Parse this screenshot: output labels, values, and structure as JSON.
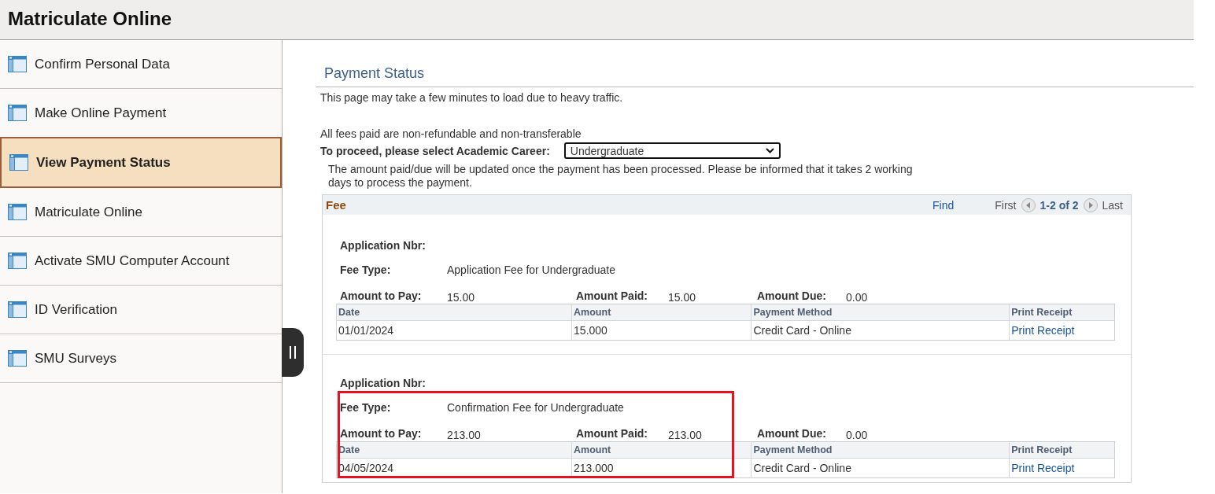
{
  "header": {
    "title": "Matriculate Online"
  },
  "sidebar": {
    "items": [
      {
        "label": "Confirm Personal Data",
        "selected": false
      },
      {
        "label": "Make Online Payment",
        "selected": false
      },
      {
        "label": "View Payment Status",
        "selected": true
      },
      {
        "label": "Matriculate Online",
        "selected": false
      },
      {
        "label": "Activate SMU Computer Account",
        "selected": false
      },
      {
        "label": "ID Verification",
        "selected": false
      },
      {
        "label": "SMU Surveys",
        "selected": false
      }
    ]
  },
  "page": {
    "title": "Payment Status",
    "notice": "This page may take a few minutes to load due to heavy traffic.",
    "fees_note": "All fees paid are non-refundable and non-transferable",
    "career_label": "To proceed, please select Academic Career:",
    "career_value": "Undergraduate",
    "update_note": "The amount paid/due will be updated once the payment has been processed. Please be informed that it takes 2 working days to process the payment."
  },
  "fee_grid": {
    "title": "Fee",
    "find": "Find",
    "first": "First",
    "range": "1-2 of 2",
    "last": "Last",
    "records": [
      {
        "application_nbr_label": "Application Nbr:",
        "fee_type_label": "Fee Type:",
        "fee_type": "Application Fee for Undergraduate",
        "amount_to_pay_label": "Amount to Pay:",
        "amount_to_pay": "15.00",
        "amount_paid_label": "Amount Paid:",
        "amount_paid": "15.00",
        "amount_due_label": "Amount Due:",
        "amount_due": "0.00",
        "highlighted": false,
        "columns": [
          "Date",
          "Amount",
          "Payment Method",
          "Print Receipt"
        ],
        "rows": [
          [
            "01/01/2024",
            "15.000",
            "Credit Card - Online",
            "Print Receipt"
          ]
        ]
      },
      {
        "application_nbr_label": "Application Nbr:",
        "fee_type_label": "Fee Type:",
        "fee_type": "Confirmation Fee for Undergraduate",
        "amount_to_pay_label": "Amount to Pay:",
        "amount_to_pay": "213.00",
        "amount_paid_label": "Amount Paid:",
        "amount_paid": "213.00",
        "amount_due_label": "Amount Due:",
        "amount_due": "0.00",
        "highlighted": true,
        "columns": [
          "Date",
          "Amount",
          "Payment Method",
          "Print Receipt"
        ],
        "rows": [
          [
            "04/05/2024",
            "213.000",
            "Credit Card - Online",
            "Print Receipt"
          ]
        ]
      }
    ]
  }
}
